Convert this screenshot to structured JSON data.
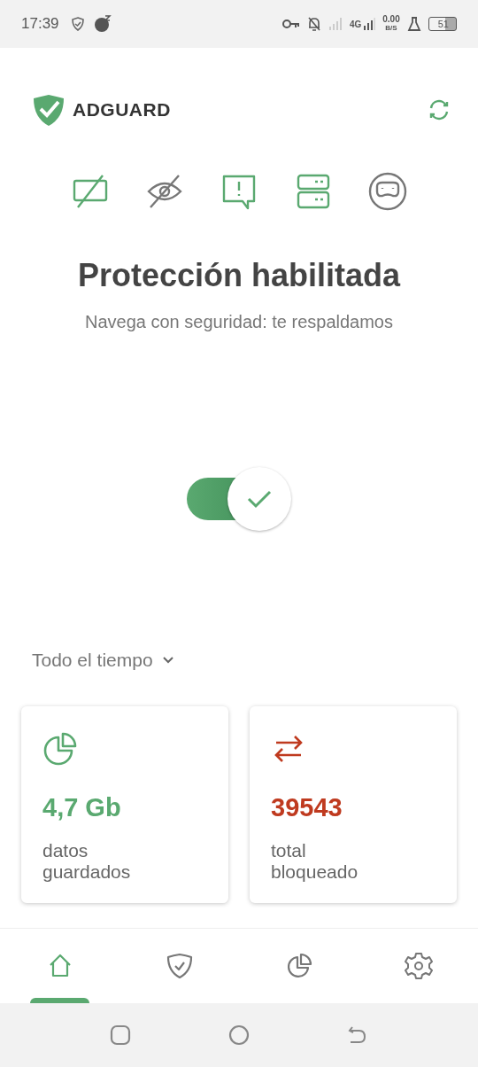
{
  "status_bar": {
    "time": "17:39",
    "network": "4G",
    "speed": "0.00",
    "speed_unit": "B/S",
    "battery": "51"
  },
  "header": {
    "logo": "ADGUARD"
  },
  "features": [
    {
      "kind": "ads",
      "on": true
    },
    {
      "kind": "tracking",
      "on": false
    },
    {
      "kind": "annoyances",
      "on": true
    },
    {
      "kind": "dns",
      "on": true
    },
    {
      "kind": "stealth",
      "on": false
    }
  ],
  "status": {
    "title": "Protección habilitada",
    "subtitle": "Navega con seguridad: te respaldamos"
  },
  "protection_toggle": {
    "on": true
  },
  "period": {
    "label": "Todo el tiempo"
  },
  "stats": [
    {
      "kind": "saved",
      "value": "4,7 Gb",
      "label": "datos guardados",
      "color": "#5aa970"
    },
    {
      "kind": "blocked",
      "value": "39543",
      "label": "total bloqueado",
      "color": "#bf3a1f"
    }
  ],
  "bottom_nav": [
    {
      "kind": "home",
      "selected": true
    },
    {
      "kind": "protection",
      "selected": false
    },
    {
      "kind": "statistics",
      "selected": false
    },
    {
      "kind": "settings",
      "selected": false
    }
  ]
}
